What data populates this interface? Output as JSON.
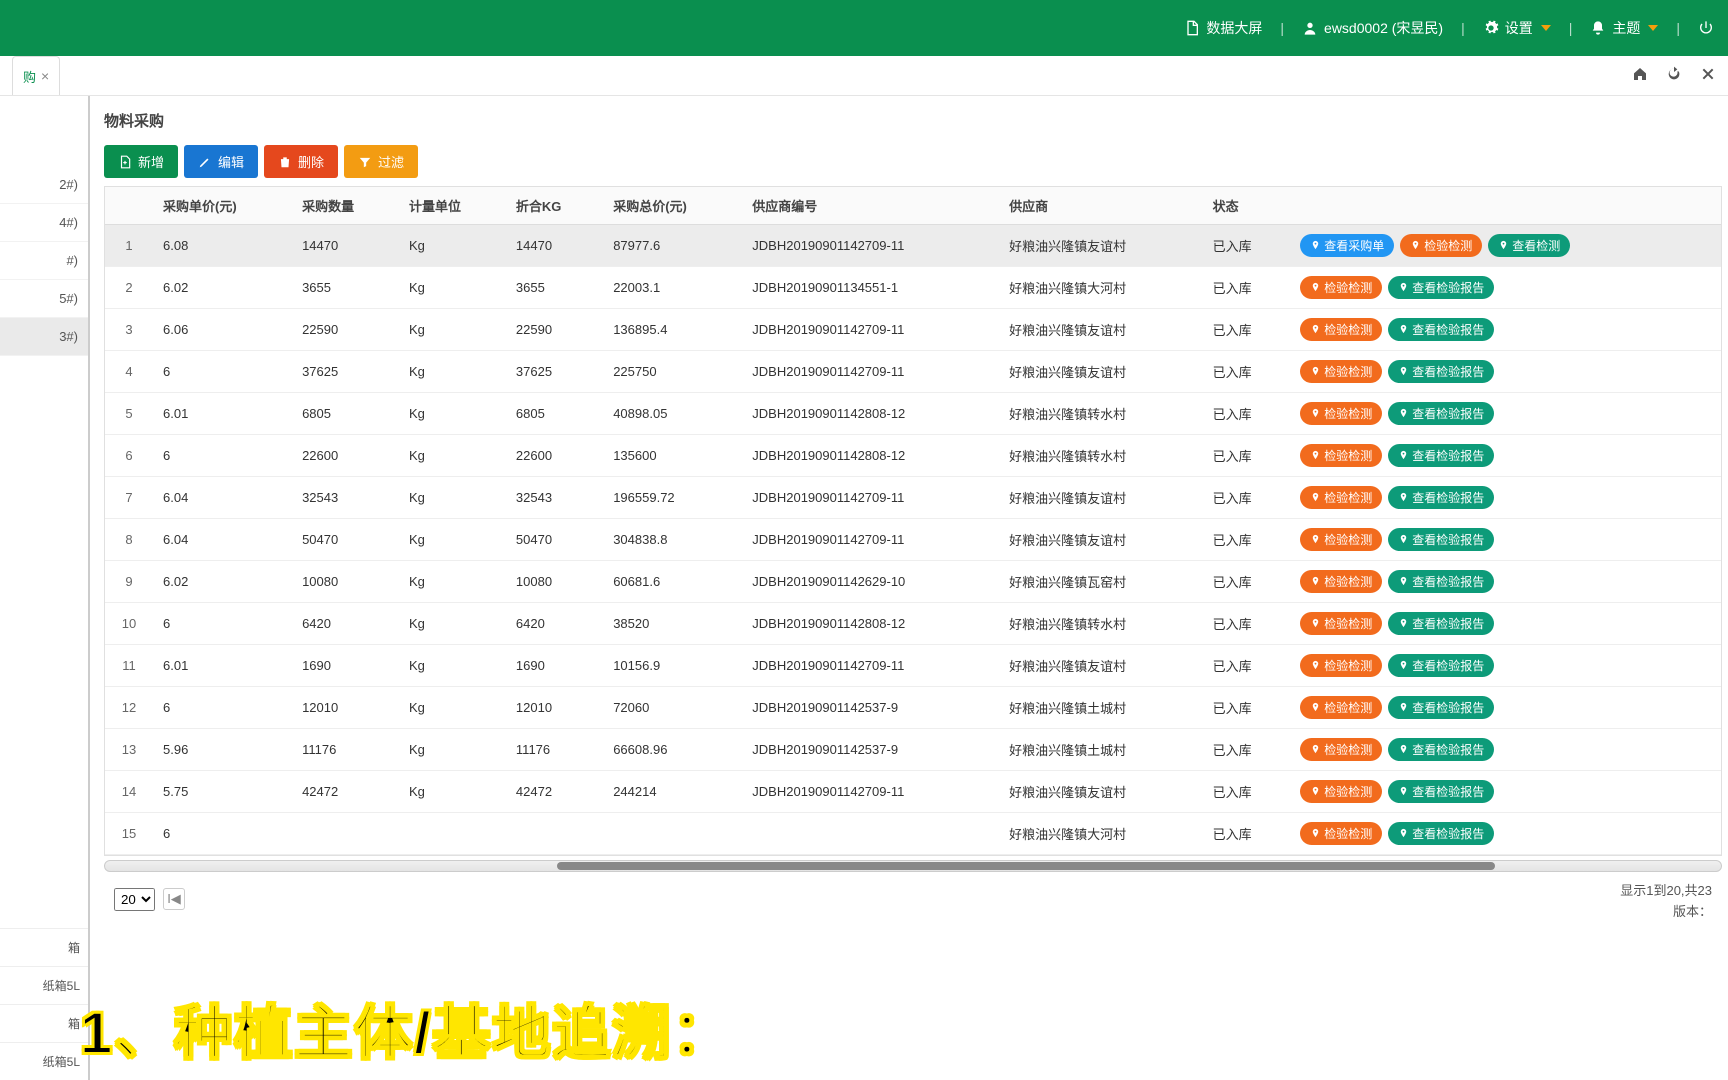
{
  "topbar": {
    "dashboard": "数据大屏",
    "user": "ewsd0002 (宋昱民)",
    "settings": "设置",
    "theme": "主题"
  },
  "tab": {
    "label": "购"
  },
  "page_title": "物料采购",
  "toolbar": {
    "add": "新增",
    "edit": "编辑",
    "delete": "删除",
    "filter": "过滤"
  },
  "columns": [
    "",
    "采购单价(元)",
    "采购数量",
    "计量单位",
    "折合KG",
    "采购总价(元)",
    "供应商编号",
    "供应商",
    "状态",
    ""
  ],
  "action_labels": {
    "view_order": "查看采购单",
    "inspect": "检验检测",
    "view_report": "查看检验报告",
    "view_inspect": "查看检测"
  },
  "rows": [
    {
      "n": 1,
      "price": "6.08",
      "qty": "14470",
      "unit": "Kg",
      "kg": "14470",
      "total": "87977.6",
      "code": "JDBH20190901142709-11",
      "supplier": "好粮油兴隆镇友谊村",
      "status": "已入库",
      "actions": [
        "view_order",
        "inspect",
        "view_inspect"
      ]
    },
    {
      "n": 2,
      "price": "6.02",
      "qty": "3655",
      "unit": "Kg",
      "kg": "3655",
      "total": "22003.1",
      "code": "JDBH20190901134551-1",
      "supplier": "好粮油兴隆镇大河村",
      "status": "已入库",
      "actions": [
        "inspect",
        "view_report"
      ]
    },
    {
      "n": 3,
      "price": "6.06",
      "qty": "22590",
      "unit": "Kg",
      "kg": "22590",
      "total": "136895.4",
      "code": "JDBH20190901142709-11",
      "supplier": "好粮油兴隆镇友谊村",
      "status": "已入库",
      "actions": [
        "inspect",
        "view_report"
      ]
    },
    {
      "n": 4,
      "price": "6",
      "qty": "37625",
      "unit": "Kg",
      "kg": "37625",
      "total": "225750",
      "code": "JDBH20190901142709-11",
      "supplier": "好粮油兴隆镇友谊村",
      "status": "已入库",
      "actions": [
        "inspect",
        "view_report"
      ]
    },
    {
      "n": 5,
      "price": "6.01",
      "qty": "6805",
      "unit": "Kg",
      "kg": "6805",
      "total": "40898.05",
      "code": "JDBH20190901142808-12",
      "supplier": "好粮油兴隆镇转水村",
      "status": "已入库",
      "actions": [
        "inspect",
        "view_report"
      ]
    },
    {
      "n": 6,
      "price": "6",
      "qty": "22600",
      "unit": "Kg",
      "kg": "22600",
      "total": "135600",
      "code": "JDBH20190901142808-12",
      "supplier": "好粮油兴隆镇转水村",
      "status": "已入库",
      "actions": [
        "inspect",
        "view_report"
      ]
    },
    {
      "n": 7,
      "price": "6.04",
      "qty": "32543",
      "unit": "Kg",
      "kg": "32543",
      "total": "196559.72",
      "code": "JDBH20190901142709-11",
      "supplier": "好粮油兴隆镇友谊村",
      "status": "已入库",
      "actions": [
        "inspect",
        "view_report"
      ]
    },
    {
      "n": 8,
      "price": "6.04",
      "qty": "50470",
      "unit": "Kg",
      "kg": "50470",
      "total": "304838.8",
      "code": "JDBH20190901142709-11",
      "supplier": "好粮油兴隆镇友谊村",
      "status": "已入库",
      "actions": [
        "inspect",
        "view_report"
      ]
    },
    {
      "n": 9,
      "price": "6.02",
      "qty": "10080",
      "unit": "Kg",
      "kg": "10080",
      "total": "60681.6",
      "code": "JDBH20190901142629-10",
      "supplier": "好粮油兴隆镇瓦窑村",
      "status": "已入库",
      "actions": [
        "inspect",
        "view_report"
      ]
    },
    {
      "n": 10,
      "price": "6",
      "qty": "6420",
      "unit": "Kg",
      "kg": "6420",
      "total": "38520",
      "code": "JDBH20190901142808-12",
      "supplier": "好粮油兴隆镇转水村",
      "status": "已入库",
      "actions": [
        "inspect",
        "view_report"
      ]
    },
    {
      "n": 11,
      "price": "6.01",
      "qty": "1690",
      "unit": "Kg",
      "kg": "1690",
      "total": "10156.9",
      "code": "JDBH20190901142709-11",
      "supplier": "好粮油兴隆镇友谊村",
      "status": "已入库",
      "actions": [
        "inspect",
        "view_report"
      ]
    },
    {
      "n": 12,
      "price": "6",
      "qty": "12010",
      "unit": "Kg",
      "kg": "12010",
      "total": "72060",
      "code": "JDBH20190901142537-9",
      "supplier": "好粮油兴隆镇土城村",
      "status": "已入库",
      "actions": [
        "inspect",
        "view_report"
      ]
    },
    {
      "n": 13,
      "price": "5.96",
      "qty": "11176",
      "unit": "Kg",
      "kg": "11176",
      "total": "66608.96",
      "code": "JDBH20190901142537-9",
      "supplier": "好粮油兴隆镇土城村",
      "status": "已入库",
      "actions": [
        "inspect",
        "view_report"
      ]
    },
    {
      "n": 14,
      "price": "5.75",
      "qty": "42472",
      "unit": "Kg",
      "kg": "42472",
      "total": "244214",
      "code": "JDBH20190901142709-11",
      "supplier": "好粮油兴隆镇友谊村",
      "status": "已入库",
      "actions": [
        "inspect",
        "view_report"
      ]
    },
    {
      "n": 15,
      "price": "6",
      "qty": "",
      "unit": "",
      "kg": "",
      "total": "",
      "code": "",
      "supplier": "好粮油兴隆镇大河村",
      "status": "已入库",
      "actions": [
        "inspect",
        "view_report"
      ]
    }
  ],
  "sidebar_top": [
    "2#)",
    "4#)",
    "#)",
    "5#)",
    "3#)"
  ],
  "sidebar_bottom": [
    "箱",
    "纸箱5L",
    "箱",
    "纸箱5L"
  ],
  "pager": {
    "size": "20",
    "info": "显示1到20,共23",
    "version": "版本："
  },
  "overlay": "1、种植主体/基地追溯："
}
